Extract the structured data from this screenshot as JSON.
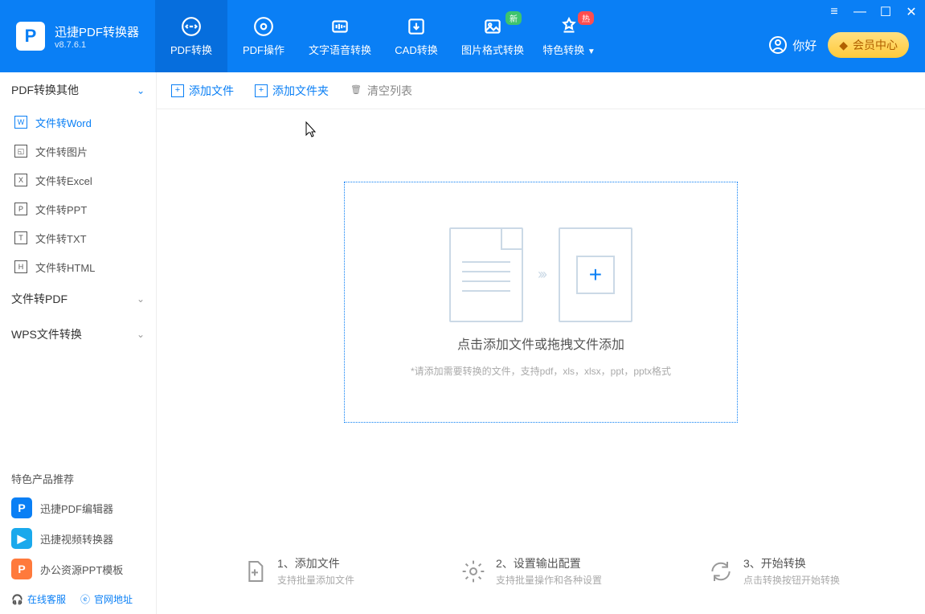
{
  "app": {
    "name": "迅捷PDF转换器",
    "version": "v8.7.6.1"
  },
  "nav": [
    {
      "label": "PDF转换",
      "active": true
    },
    {
      "label": "PDF操作"
    },
    {
      "label": "文字语音转换"
    },
    {
      "label": "CAD转换"
    },
    {
      "label": "图片格式转换",
      "badge": "新",
      "badge_color": "green"
    },
    {
      "label": "特色转换",
      "badge": "热",
      "badge_color": "red",
      "dropdown": true
    }
  ],
  "user": {
    "greeting": "你好",
    "member_btn": "会员中心"
  },
  "sidebar": {
    "cat1": {
      "title": "PDF转换其他",
      "expanded": true,
      "items": [
        {
          "label": "文件转Word",
          "active": true,
          "mark": "W"
        },
        {
          "label": "文件转图片",
          "mark": "◱"
        },
        {
          "label": "文件转Excel",
          "mark": "X"
        },
        {
          "label": "文件转PPT",
          "mark": "P"
        },
        {
          "label": "文件转TXT",
          "mark": "T"
        },
        {
          "label": "文件转HTML",
          "mark": "H"
        }
      ]
    },
    "cat2": {
      "title": "文件转PDF"
    },
    "cat3": {
      "title": "WPS文件转换"
    },
    "featured_title": "特色产品推荐",
    "featured": [
      {
        "label": "迅捷PDF编辑器",
        "icon": "P",
        "color": "blue"
      },
      {
        "label": "迅捷视频转换器",
        "icon": "▶",
        "color": "cyan"
      },
      {
        "label": "办公资源PPT模板",
        "icon": "P",
        "color": "orange"
      }
    ],
    "footer": {
      "support": "在线客服",
      "website": "官网地址"
    }
  },
  "toolbar": {
    "add_file": "添加文件",
    "add_folder": "添加文件夹",
    "clear": "清空列表"
  },
  "dropzone": {
    "title": "点击添加文件或拖拽文件添加",
    "sub": "*请添加需要转换的文件，支持pdf，xls，xlsx，ppt，pptx格式"
  },
  "steps": [
    {
      "title": "1、添加文件",
      "sub": "支持批量添加文件"
    },
    {
      "title": "2、设置输出配置",
      "sub": "支持批量操作和各种设置"
    },
    {
      "title": "3、开始转换",
      "sub": "点击转换按钮开始转换"
    }
  ]
}
